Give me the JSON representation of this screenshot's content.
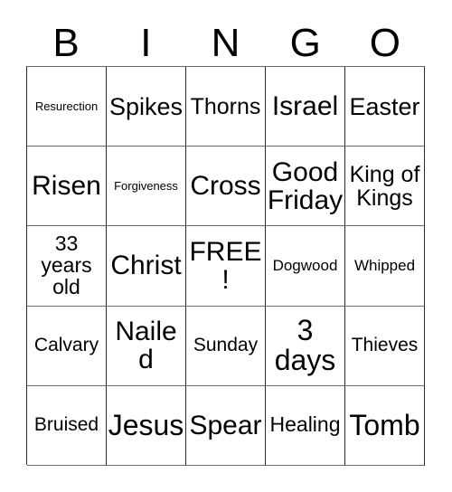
{
  "card": {
    "kind": "bingo-card",
    "header": {
      "letters": [
        "B",
        "I",
        "N",
        "G",
        "O"
      ]
    },
    "grid": {
      "columns": 5,
      "rows": 5,
      "free_space": "FREE!",
      "border_color": "#2a2a2a",
      "background_color": "#ffffff",
      "text_color": "#000000",
      "cells": [
        [
          {
            "text": "Resurection",
            "size": "fs-xs"
          },
          {
            "text": "Spikes",
            "size": "fs-xl"
          },
          {
            "text": "Thorns",
            "size": "fs-l"
          },
          {
            "text": "Israel",
            "size": "fs-xxl"
          },
          {
            "text": "Easter",
            "size": "fs-xl"
          }
        ],
        [
          {
            "text": "Risen",
            "size": "fs-xxl"
          },
          {
            "text": "Forgiveness",
            "size": "fs-xs"
          },
          {
            "text": "Cross",
            "size": "fs-xxl"
          },
          {
            "text": "Good\nFriday",
            "size": "fs-xxl"
          },
          {
            "text": "King of\nKings",
            "size": "fs-l"
          }
        ],
        [
          {
            "text": "33\nyears\nold",
            "size": "fs-ml"
          },
          {
            "text": "Christ",
            "size": "fs-xxl"
          },
          {
            "text": "FREE!",
            "size": "fs-xxl"
          },
          {
            "text": "Dogwood",
            "size": "fs-s"
          },
          {
            "text": "Whipped",
            "size": "fs-s"
          }
        ],
        [
          {
            "text": "Calvary",
            "size": "fs-m"
          },
          {
            "text": "Nailed",
            "size": "fs-xxl"
          },
          {
            "text": "Sunday",
            "size": "fs-m"
          },
          {
            "text": "3\ndays",
            "size": "fs-3xl"
          },
          {
            "text": "Thieves",
            "size": "fs-m"
          }
        ],
        [
          {
            "text": "Bruised",
            "size": "fs-m"
          },
          {
            "text": "Jesus",
            "size": "fs-3xl"
          },
          {
            "text": "Spear",
            "size": "fs-xxl"
          },
          {
            "text": "Healing",
            "size": "fs-ml"
          },
          {
            "text": "Tomb",
            "size": "fs-3xl"
          }
        ]
      ]
    }
  }
}
